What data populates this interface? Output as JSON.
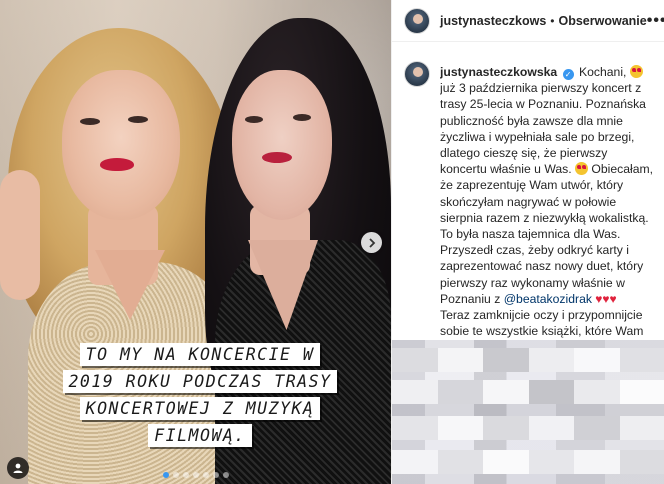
{
  "post": {
    "caption_overlay": [
      "TO MY NA KONCERCIE W",
      "2019 ROKU PODCZAS TRASY",
      "KONCERTOWEJ Z MUZYKĄ",
      "FILMOWĄ."
    ],
    "carousel": {
      "slides": 7,
      "active_index": 0
    },
    "icons": {
      "next": "chevron-right-icon",
      "tag": "user-tag-icon"
    }
  },
  "header": {
    "username": "justynasteczkows",
    "separator": "•",
    "follow_label": "Obserwowanie",
    "more_label": "•••"
  },
  "caption": {
    "username": "justynasteczkowska",
    "verified_mark": "✓",
    "text_1": " Kochani, ",
    "text_2": " już 3 października pierwszy koncert z trasy 25-lecia w Poznaniu. Poznańska publiczność była zawsze dla mnie życzliwa i wypełniała sale po brzegi, dlatego cieszę się, że pierwszy koncertu właśnie u Was. ",
    "text_3": " Obiecałam, że zaprezentuję Wam utwór, który skończyłam nagrywać w połowie sierpnia razem z niezwykłą wokalistką. To była nasza tajemnica dla Was. Przyszedł czas, żeby odkryć karty i zaprezentować nasz nowy duet, który pierwszy raz wykonamy właśnie w Poznaniu z ",
    "mention": "@beatakozidrak",
    "hearts": " ♥♥♥",
    "text_4": "Teraz zamknijcie oczy i przypomnijcie sobie te wszystkie książki, które Wam polecałam, których podstawą jest miłość, empatia i szacunek do drugiego człowieka i PROSZĘ Was Kochani ",
    "heart_end": "♥"
  },
  "colors": {
    "accent": "#3897f0",
    "heart": "#e0223c",
    "mention": "#003569"
  }
}
